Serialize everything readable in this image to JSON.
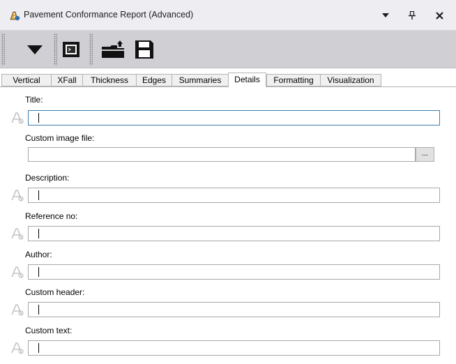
{
  "window": {
    "title": "Pavement Conformance Report (Advanced)",
    "menu_icon": "dropdown-arrow-icon",
    "pin_icon": "pin-icon",
    "close_icon": "close-icon"
  },
  "toolbar": {
    "items": [
      "dropdown-arrow-icon",
      "report-window-icon",
      "open-folder-icon",
      "save-disk-icon"
    ]
  },
  "tabs": [
    {
      "label": "Vertical",
      "active": false
    },
    {
      "label": "XFall",
      "active": false
    },
    {
      "label": "Thickness",
      "active": false
    },
    {
      "label": "Edges",
      "active": false
    },
    {
      "label": "Summaries",
      "active": false
    },
    {
      "label": "Details",
      "active": true
    },
    {
      "label": "Formatting",
      "active": false
    },
    {
      "label": "Visualization",
      "active": false
    }
  ],
  "details": {
    "title_label": "Title:",
    "title_value": "",
    "custom_image_label": "Custom image file:",
    "custom_image_value": "",
    "browse_label": "...",
    "description_label": "Description:",
    "description_value": "",
    "reference_label": "Reference no:",
    "reference_value": "",
    "author_label": "Author:",
    "author_value": "",
    "custom_header_label": "Custom header:",
    "custom_header_value": "",
    "custom_text_label": "Custom text:",
    "custom_text_value": ""
  },
  "colors": {
    "title_bar": "#eeeef2",
    "toolbar": "#cfcfd4",
    "focus_border": "#3c7fb1"
  }
}
